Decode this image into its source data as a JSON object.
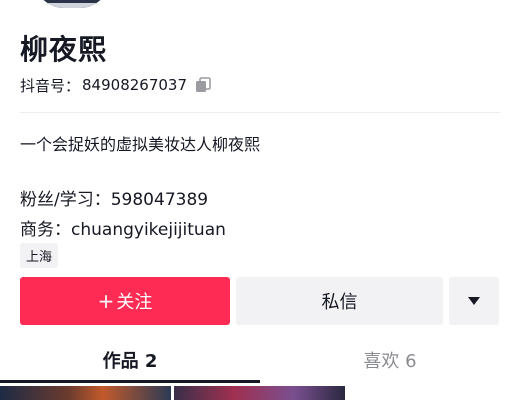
{
  "profile": {
    "name": "柳夜熙",
    "id_label": "抖音号：",
    "id_value": "84908267037",
    "bio": "一个会捉妖的虚拟美妆达人柳夜熙",
    "fans_label": "粉丝/学习：",
    "fans_value": "598047389",
    "business_label": "商务：",
    "business_value": "chuangyikejijituan",
    "location": "上海"
  },
  "actions": {
    "follow_plus": "+",
    "follow_label": "关注",
    "message_label": "私信",
    "more_icon": "triangle-down-icon"
  },
  "tabs": [
    {
      "label": "作品 2",
      "active": true
    },
    {
      "label": "喜欢 6",
      "active": false
    }
  ],
  "colors": {
    "accent": "#fe2c55",
    "text": "#161823",
    "muted": "#8a8b91",
    "button_bg": "#f2f2f4"
  }
}
